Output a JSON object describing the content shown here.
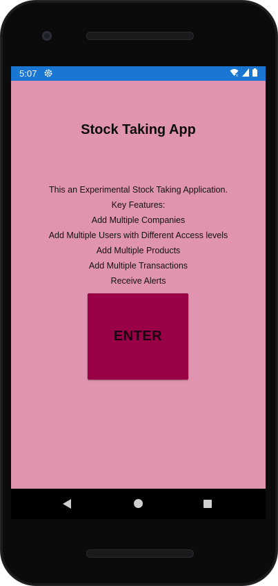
{
  "status_bar": {
    "time": "5:07",
    "color": "#1976d2",
    "icons": [
      "gear-icon",
      "wifi-icon",
      "signal-icon",
      "battery-icon"
    ]
  },
  "app": {
    "title": "Stock Taking App",
    "background_color": "#e194b0",
    "description_lines": [
      "This an Experimental Stock Taking Application.",
      "Key Features:",
      "Add Multiple Companies",
      "Add Multiple Users with Different Access levels",
      "Add Multiple Products",
      "Add Multiple Transactions",
      "Receive Alerts"
    ],
    "enter_button": {
      "label": "ENTER",
      "color": "#9a0046"
    }
  },
  "nav_bar": {
    "icons": [
      "back-icon",
      "home-icon",
      "recents-icon"
    ]
  }
}
